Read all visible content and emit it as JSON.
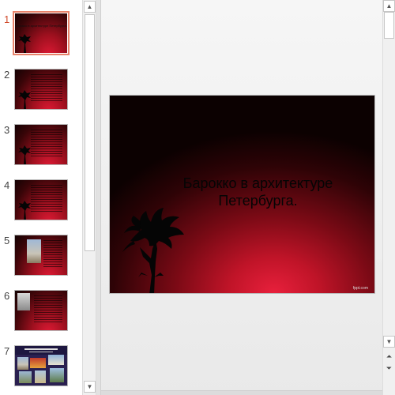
{
  "slides_panel": {
    "items": [
      {
        "number": "1",
        "title": "Барокко в архитектуре Петербурга."
      },
      {
        "number": "2"
      },
      {
        "number": "3"
      },
      {
        "number": "4"
      },
      {
        "number": "5"
      },
      {
        "number": "6"
      },
      {
        "number": "7"
      }
    ],
    "selected": "1"
  },
  "main_slide": {
    "title_line1": "Барокко в архитектуре",
    "title_line2": "Петербурга.",
    "logo": "fppt.com"
  },
  "scrollbar": {
    "up_icon": "arrow-up-icon",
    "down_icon": "arrow-down-icon",
    "prev_page_icon": "double-chevron-up-icon",
    "next_page_icon": "double-chevron-down-icon"
  },
  "colors": {
    "selection_border": "#e8826a",
    "slide_accent": "#e01a35",
    "slide_dark": "#0c0101"
  }
}
